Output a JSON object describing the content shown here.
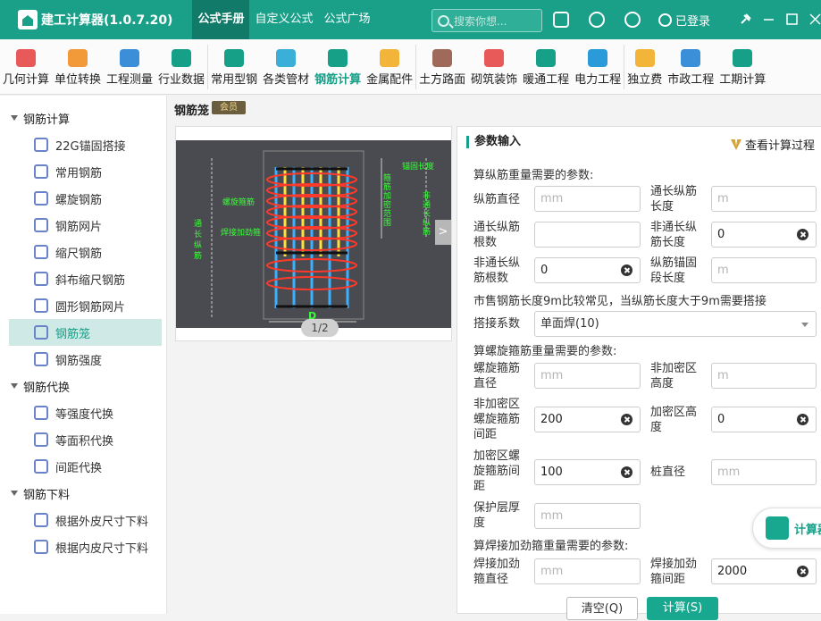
{
  "app": {
    "title": "建工计算器(1.0.7.20)"
  },
  "nav": {
    "tabs": [
      "公式手册",
      "自定义公式",
      "公式广场"
    ],
    "active": 0
  },
  "search": {
    "placeholder": "搜索你想..."
  },
  "user": {
    "status": "已登录"
  },
  "toolbar": {
    "items": [
      {
        "label": "几何计算",
        "icon": "cube-icon",
        "color": "#e85a5a"
      },
      {
        "label": "单位转换",
        "icon": "unit-cm-icon",
        "color": "#f29a3a"
      },
      {
        "label": "工程测量",
        "icon": "measure-icon",
        "color": "#3a8fd8"
      },
      {
        "label": "行业数据",
        "icon": "bar-chart-icon",
        "color": "#16a088"
      },
      {
        "label": "常用型钢",
        "icon": "tools-icon",
        "color": "#16a088"
      },
      {
        "label": "各类管材",
        "icon": "pipe-icon",
        "color": "#3ab0d8"
      },
      {
        "label": "钢筋计算",
        "icon": "rebar-icon",
        "color": "#16a088"
      },
      {
        "label": "金属配件",
        "icon": "metal-fitting-icon",
        "color": "#f2b53a"
      },
      {
        "label": "土方路面",
        "icon": "earthwork-icon",
        "color": "#a06a5a"
      },
      {
        "label": "砌筑装饰",
        "icon": "brick-icon",
        "color": "#e85a5a"
      },
      {
        "label": "暖通工程",
        "icon": "fan-icon",
        "color": "#16a088"
      },
      {
        "label": "电力工程",
        "icon": "power-house-icon",
        "color": "#2a9bd8"
      },
      {
        "label": "独立费",
        "icon": "fee-icon",
        "color": "#f2b53a"
      },
      {
        "label": "市政工程",
        "icon": "municipal-icon",
        "color": "#3a8fd8"
      },
      {
        "label": "工期计算",
        "icon": "calendar-icon",
        "color": "#16a088"
      }
    ],
    "active": 6
  },
  "sidebar": {
    "groups": [
      {
        "label": "钢筋计算",
        "items": [
          "22G锚固搭接",
          "常用钢筋",
          "螺旋钢筋",
          "钢筋网片",
          "缩尺钢筋",
          "斜布缩尺钢筋",
          "圆形钢筋网片",
          "钢筋笼",
          "钢筋强度"
        ]
      },
      {
        "label": "钢筋代换",
        "items": [
          "等强度代换",
          "等面积代换",
          "间距代换"
        ]
      },
      {
        "label": "钢筋下料",
        "items": [
          "根据外皮尺寸下料",
          "根据内皮尺寸下料"
        ]
      }
    ],
    "active": "钢筋笼"
  },
  "page": {
    "title": "钢筋笼",
    "vip": "会员"
  },
  "diagram": {
    "pager": "1/2",
    "labels": {
      "anchor": "锚固长度",
      "stirrup_zone": "箍筋加密范围",
      "through_rebar": "通长纵筋",
      "non_through": "非通长纵筋",
      "spiral": "螺旋箍筋",
      "weld_ring": "焊接加劲箍",
      "diameter": "D"
    }
  },
  "form": {
    "header": "参数输入",
    "calc_link": "查看计算过程",
    "sec_long": "算纵筋重量需要的参数:",
    "sec_spiral": "算螺旋箍筋重量需要的参数:",
    "sec_weld": "算焊接加劲箍重量需要的参数:",
    "note": "市售钢筋长度9m比较常见，当纵筋长度大于9m需要搭接",
    "fields": {
      "long_dia": {
        "label": "纵筋直径",
        "value": "",
        "placeholder": "mm"
      },
      "through_len": {
        "label": "通长纵筋长度",
        "value": "",
        "placeholder": "m"
      },
      "through_count": {
        "label": "通长纵筋根数",
        "value": "",
        "placeholder": ""
      },
      "non_through_len": {
        "label": "非通长纵筋长度",
        "value": "0",
        "placeholder": ""
      },
      "non_through_count": {
        "label": "非通长纵筋根数",
        "value": "0",
        "placeholder": ""
      },
      "anchor_len": {
        "label": "纵筋锚固段长度",
        "value": "",
        "placeholder": "m"
      },
      "splice": {
        "label": "搭接系数",
        "value": "单面焊(10)"
      },
      "spiral_dia": {
        "label": "螺旋箍筋直径",
        "value": "",
        "placeholder": "mm"
      },
      "non_dense_h": {
        "label": "非加密区高度",
        "value": "",
        "placeholder": "m"
      },
      "non_dense_spacing": {
        "label": "非加密区螺旋箍筋间距",
        "value": "200",
        "placeholder": ""
      },
      "dense_h": {
        "label": "加密区高度",
        "value": "0",
        "placeholder": ""
      },
      "dense_spacing": {
        "label": "加密区螺旋箍筋间距",
        "value": "100",
        "placeholder": ""
      },
      "pile_dia": {
        "label": "桩直径",
        "value": "",
        "placeholder": "mm"
      },
      "cover": {
        "label": "保护层厚度",
        "value": "",
        "placeholder": "mm"
      },
      "weld_dia": {
        "label": "焊接加劲箍直径",
        "value": "",
        "placeholder": "mm"
      },
      "weld_spacing": {
        "label": "焊接加劲箍间距",
        "value": "2000",
        "placeholder": ""
      }
    },
    "buttons": {
      "clear": "清空(Q)",
      "calc": "计算(S)"
    },
    "float": "计算器"
  }
}
